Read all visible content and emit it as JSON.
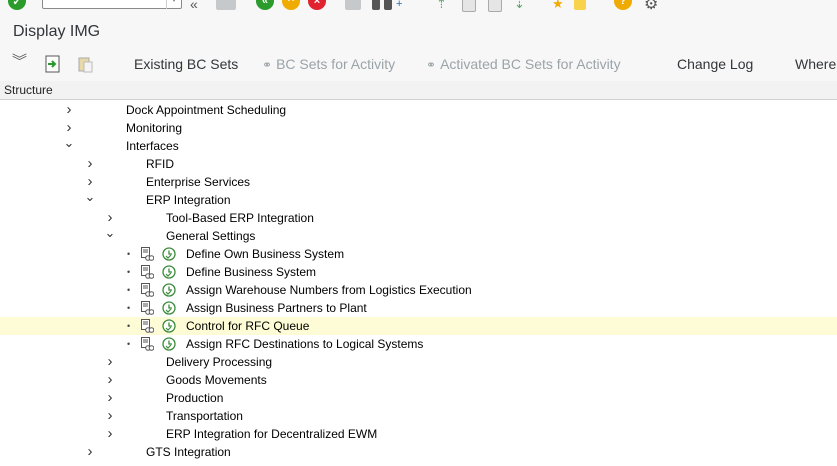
{
  "window": {
    "title": "Display IMG"
  },
  "toolbar": {
    "command_field_value": "",
    "buttons": [
      "Existing BC Sets",
      "BC Sets for Activity",
      "Activated BC Sets for Activity",
      "Change Log",
      "Where"
    ],
    "disabled_buttons": [
      "BC Sets for Activity",
      "Activated BC Sets for Activity"
    ]
  },
  "structure": {
    "header": "Structure",
    "rows": [
      {
        "label": "Dock Appointment Scheduling",
        "level": 0,
        "expander": "collapsed"
      },
      {
        "label": "Monitoring",
        "level": 0,
        "expander": "collapsed"
      },
      {
        "label": "Interfaces",
        "level": 0,
        "expander": "expanded"
      },
      {
        "label": "RFID",
        "level": 1,
        "expander": "collapsed"
      },
      {
        "label": "Enterprise Services",
        "level": 1,
        "expander": "collapsed"
      },
      {
        "label": "ERP Integration",
        "level": 1,
        "expander": "expanded"
      },
      {
        "label": "Tool-Based ERP Integration",
        "level": 2,
        "expander": "collapsed"
      },
      {
        "label": "General Settings",
        "level": 2,
        "expander": "expanded"
      },
      {
        "label": "Define Own Business System",
        "level": 2,
        "expander": "activity"
      },
      {
        "label": "Define Business System",
        "level": 2,
        "expander": "activity"
      },
      {
        "label": "Assign Warehouse Numbers from Logistics Execution",
        "level": 2,
        "expander": "activity"
      },
      {
        "label": "Assign Business Partners to Plant",
        "level": 2,
        "expander": "activity"
      },
      {
        "label": "Control for RFC Queue",
        "level": 2,
        "expander": "activity",
        "selected": true
      },
      {
        "label": "Assign RFC Destinations to Logical Systems",
        "level": 2,
        "expander": "activity"
      },
      {
        "label": "Delivery Processing",
        "level": 2,
        "expander": "collapsed"
      },
      {
        "label": "Goods Movements",
        "level": 2,
        "expander": "collapsed"
      },
      {
        "label": "Production",
        "level": 2,
        "expander": "collapsed"
      },
      {
        "label": "Transportation",
        "level": 2,
        "expander": "collapsed"
      },
      {
        "label": "ERP Integration for Decentralized EWM",
        "level": 2,
        "expander": "collapsed"
      },
      {
        "label": "GTS Integration",
        "level": 1,
        "expander": "collapsed"
      }
    ]
  },
  "colors": {
    "selected_row": "#fdfcd6",
    "toolbar_bg": "#f7f7f7",
    "ok_green": "#2b9b2b",
    "back_orange": "#f0ab00",
    "cancel_red": "#e0232f",
    "help_yellow": "#f0ab00"
  },
  "icons": [
    "enter-icon",
    "back-icon",
    "exit-icon",
    "cancel-icon",
    "find-icon",
    "help-icon",
    "settings-icon",
    "expand-all-icon",
    "execute-icon",
    "paste-icon",
    "document-icon",
    "activity-clock-icon",
    "chevron-right-icon",
    "chevron-down-icon"
  ]
}
